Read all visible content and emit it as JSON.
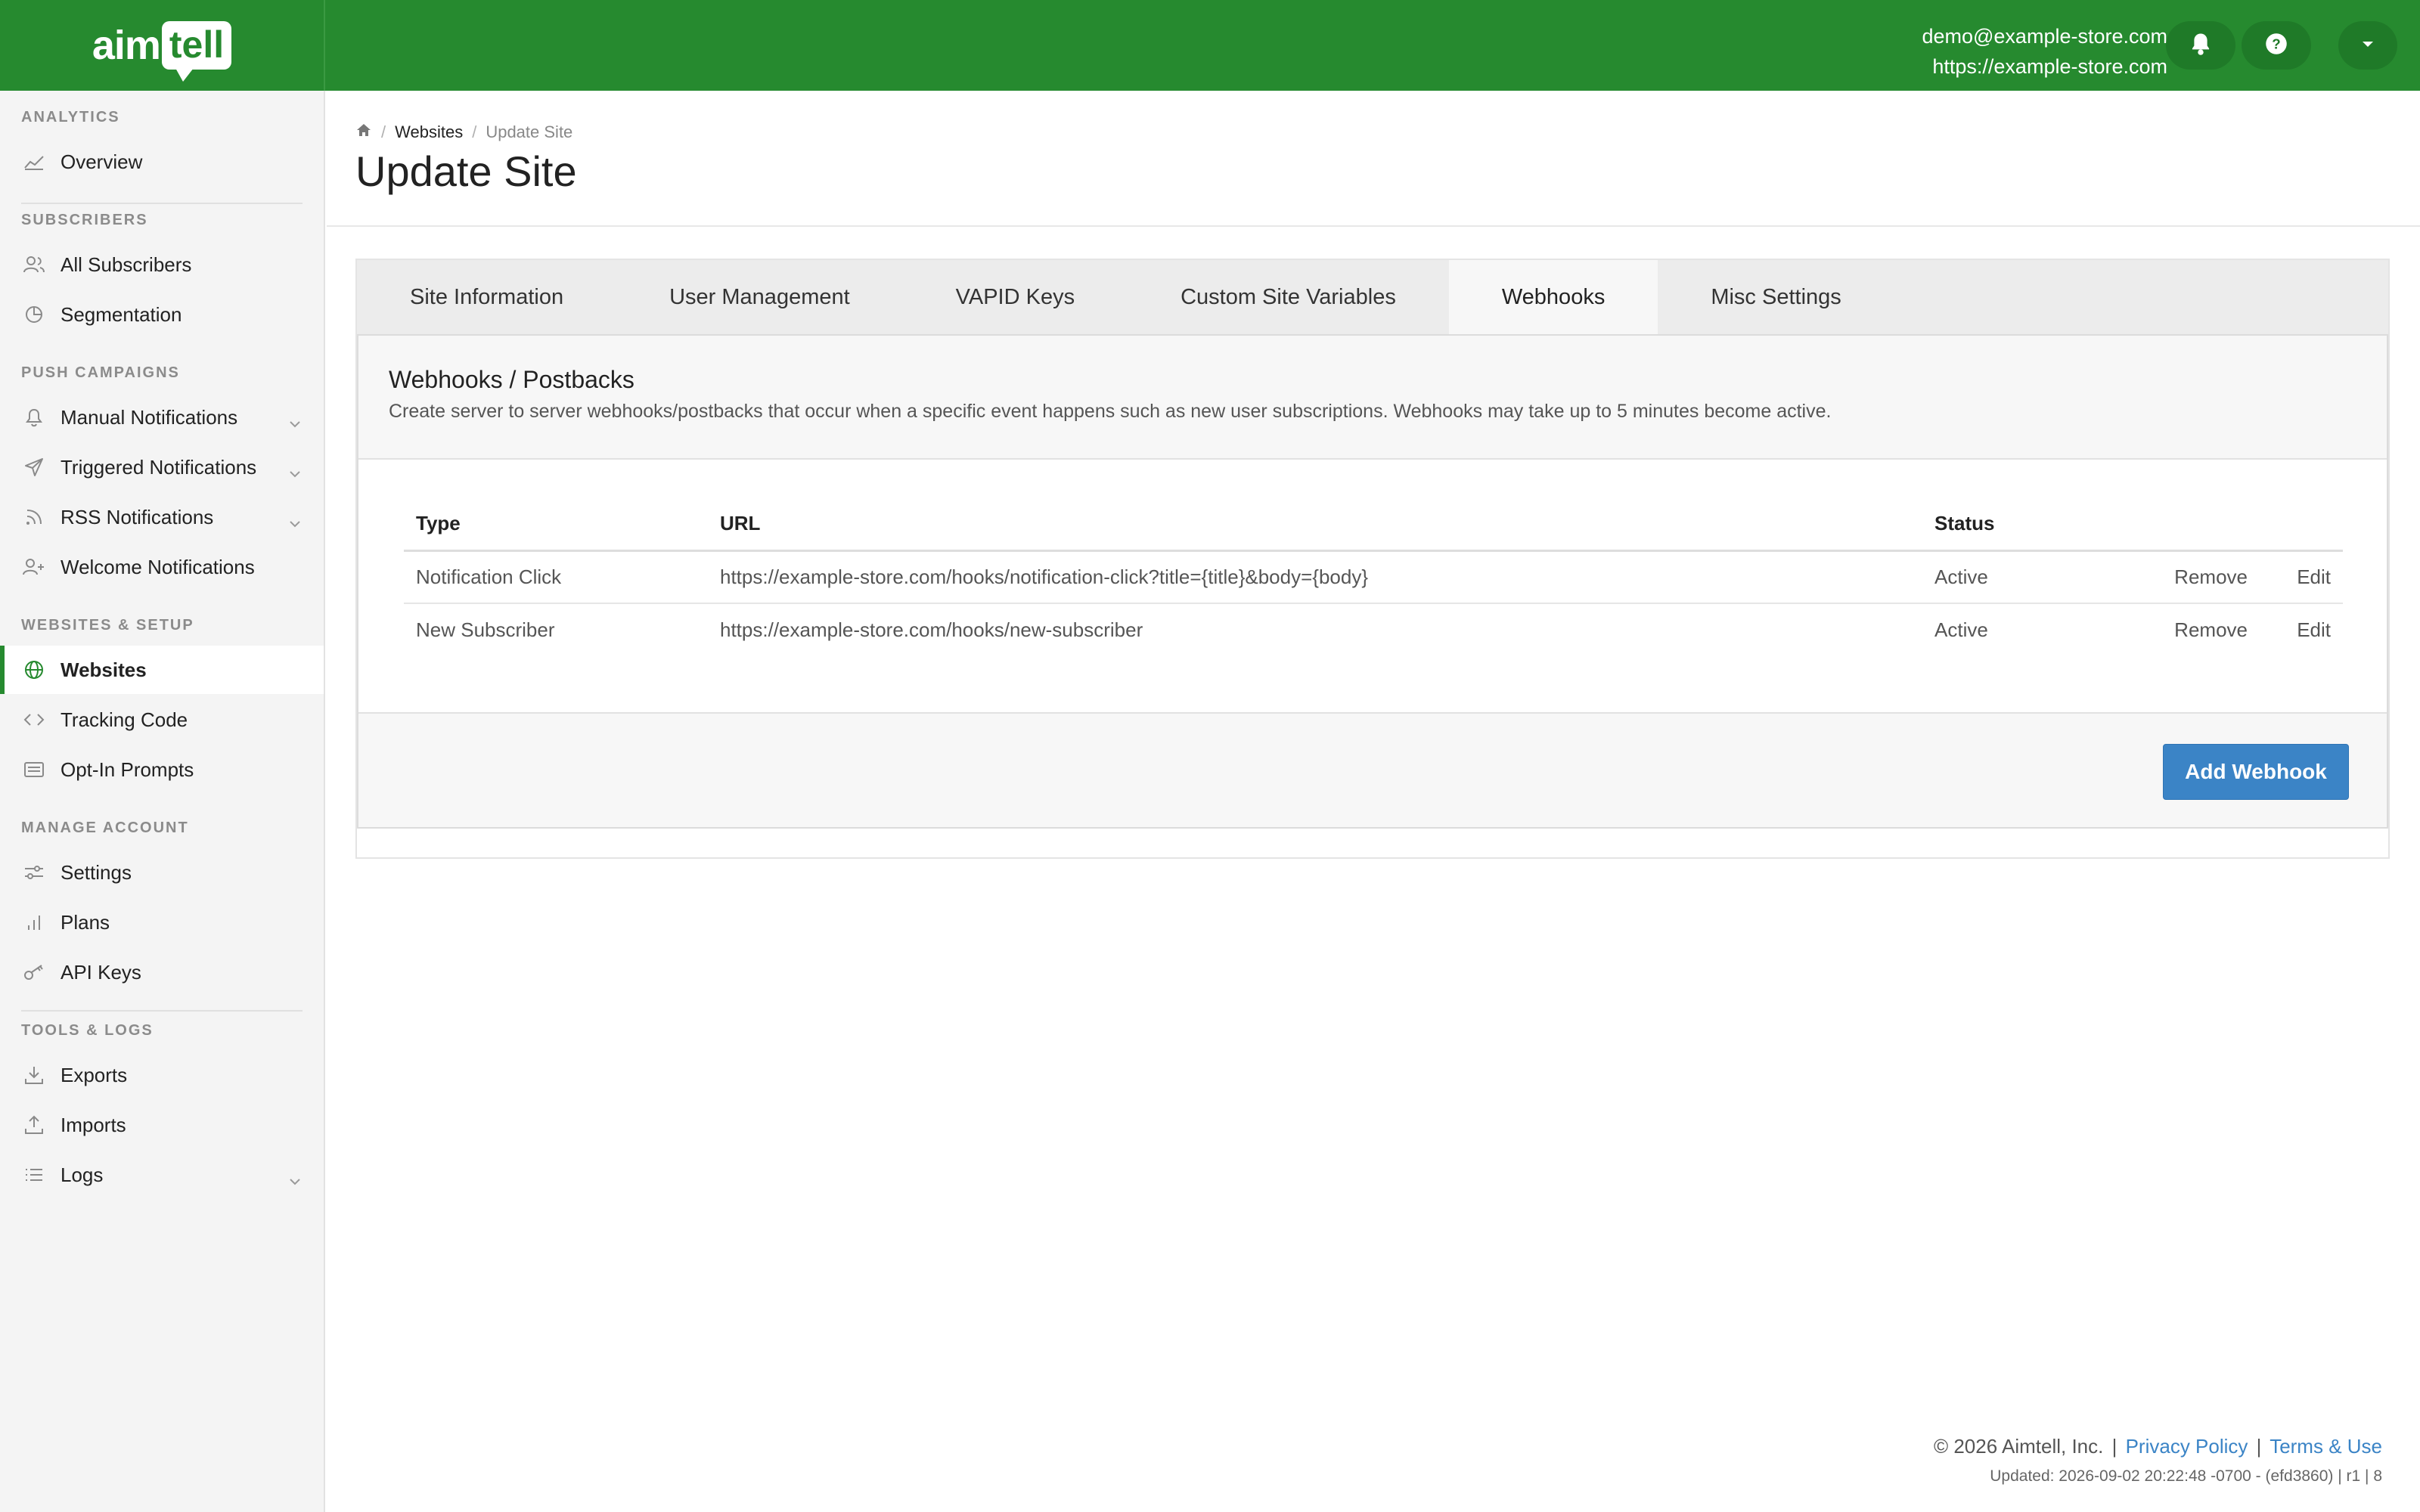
{
  "topbar": {
    "logo_aim": "aim",
    "logo_tell": "tell",
    "user_email": "demo@example-store.com",
    "user_site": "https://example-store.com",
    "brand_color": "#268a2f",
    "icons": [
      "bell-icon",
      "help-icon",
      "caret-down-icon"
    ]
  },
  "sidebar": {
    "sections": [
      {
        "title": "ANALYTICS",
        "items": [
          {
            "label": "Overview",
            "icon": "chart-line-icon"
          }
        ]
      },
      {
        "title": "SUBSCRIBERS",
        "items": [
          {
            "label": "All Subscribers",
            "icon": "users-icon"
          },
          {
            "label": "Segmentation",
            "icon": "pie-chart-icon"
          }
        ]
      },
      {
        "title": "PUSH CAMPAIGNS",
        "items": [
          {
            "label": "Manual Notifications",
            "icon": "bell-icon",
            "expandable": true
          },
          {
            "label": "Triggered Notifications",
            "icon": "paper-plane-icon",
            "expandable": true
          },
          {
            "label": "RSS Notifications",
            "icon": "rss-icon",
            "expandable": true
          },
          {
            "label": "Welcome Notifications",
            "icon": "user-plus-icon"
          }
        ]
      },
      {
        "title": "WEBSITES & SETUP",
        "items": [
          {
            "label": "Websites",
            "icon": "globe-icon",
            "active": true
          },
          {
            "label": "Tracking Code",
            "icon": "code-icon"
          },
          {
            "label": "Opt-In Prompts",
            "icon": "prompt-window-icon"
          }
        ]
      },
      {
        "title": "MANAGE ACCOUNT",
        "items": [
          {
            "label": "Settings",
            "icon": "sliders-icon"
          },
          {
            "label": "Plans",
            "icon": "bar-chart-icon"
          },
          {
            "label": "API Keys",
            "icon": "key-icon"
          }
        ]
      },
      {
        "title": "TOOLS & LOGS",
        "items": [
          {
            "label": "Exports",
            "icon": "download-icon"
          },
          {
            "label": "Imports",
            "icon": "upload-icon"
          },
          {
            "label": "Logs",
            "icon": "list-icon",
            "expandable": true
          }
        ]
      }
    ]
  },
  "header": {
    "breadcrumb": {
      "home_icon": "home-icon",
      "websites": "Websites",
      "current": "Update Site"
    },
    "title": "Update Site"
  },
  "tabs": [
    {
      "label": "Site Information"
    },
    {
      "label": "User Management"
    },
    {
      "label": "VAPID Keys"
    },
    {
      "label": "Custom Site Variables"
    },
    {
      "label": "Webhooks",
      "active": true
    },
    {
      "label": "Misc Settings"
    }
  ],
  "webhooks": {
    "title": "Webhooks / Postbacks",
    "description": "Create server to server webhooks/postbacks that occur when a specific event happens such as new user subscriptions. Webhooks may take up to 5 minutes become active.",
    "columns": {
      "type": "Type",
      "url": "URL",
      "status": "Status"
    },
    "rows": [
      {
        "type": "Notification Click",
        "url": "https://example-store.com/hooks/notification-click?title={title}&body={body}",
        "status": "Active",
        "remove": "Remove",
        "edit": "Edit"
      },
      {
        "type": "New Subscriber",
        "url": "https://example-store.com/hooks/new-subscriber",
        "status": "Active",
        "remove": "Remove",
        "edit": "Edit"
      }
    ],
    "add_button": "Add Webhook",
    "accent_color": "#3b84c6"
  },
  "footer": {
    "copyright": "© 2026 Aimtell, Inc.",
    "privacy": "Privacy Policy",
    "terms": "Terms & Use",
    "separator": "|",
    "updated": "Updated: 2026-09-02 20:22:48 -0700 - (efd3860) | r1 | 8"
  }
}
